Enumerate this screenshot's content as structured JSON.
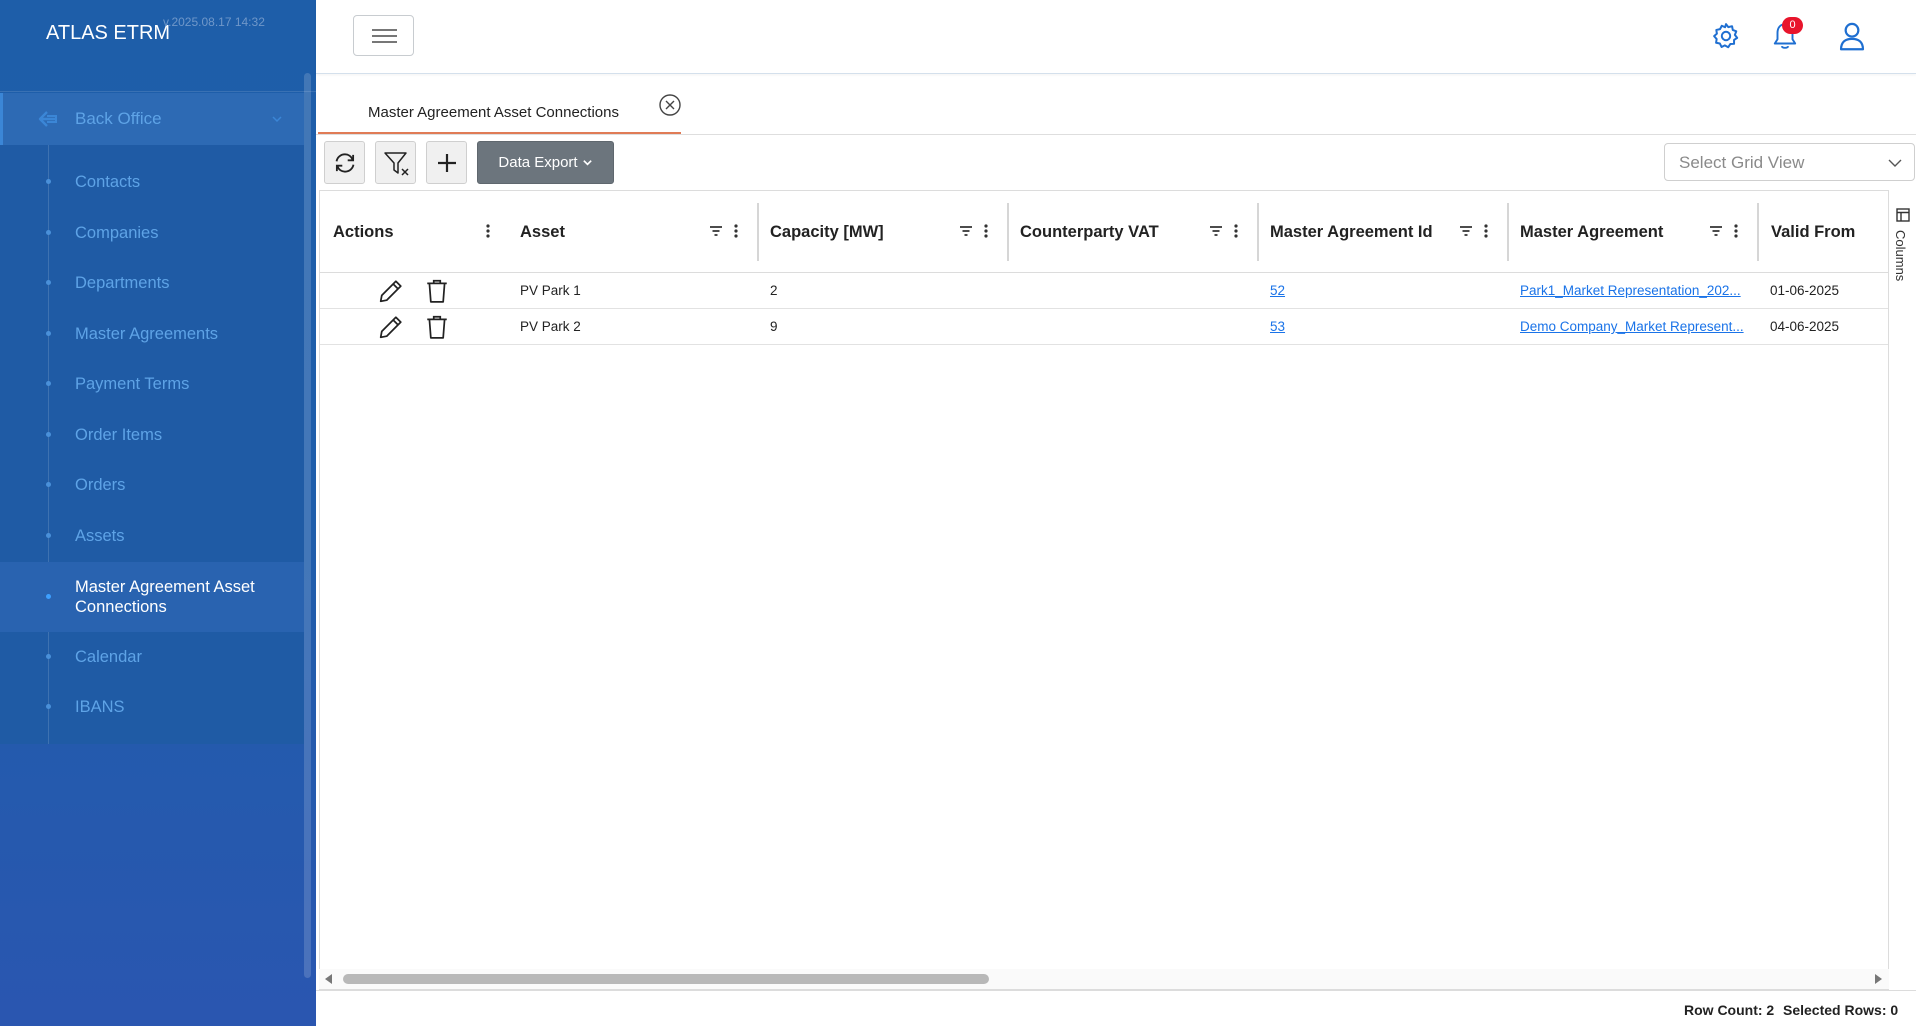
{
  "app": {
    "title": "ATLAS ETRM",
    "version": "v.2025.08.17 14:32"
  },
  "sidebar": {
    "section": {
      "label": "Back Office",
      "icon": "back-arrow-icon"
    },
    "items": [
      {
        "label": "Contacts",
        "active": false
      },
      {
        "label": "Companies",
        "active": false
      },
      {
        "label": "Departments",
        "active": false
      },
      {
        "label": "Master Agreements",
        "active": false
      },
      {
        "label": "Payment Terms",
        "active": false
      },
      {
        "label": "Order Items",
        "active": false
      },
      {
        "label": "Orders",
        "active": false
      },
      {
        "label": "Assets",
        "active": false
      },
      {
        "label": "Master Agreement Asset Connections",
        "active": true
      },
      {
        "label": "Calendar",
        "active": false
      },
      {
        "label": "IBANS",
        "active": false
      }
    ]
  },
  "header": {
    "notification_count": "0",
    "icons": [
      "menu-icon",
      "gear-icon",
      "bell-icon",
      "user-icon"
    ]
  },
  "tabs": [
    {
      "label": "Master Agreement Asset Connections"
    }
  ],
  "toolbar": {
    "refresh_icon": "refresh-icon",
    "clear_filter_icon": "filter-clear-icon",
    "add_icon": "plus-icon",
    "export_label": "Data Export",
    "grid_view_placeholder": "Select Grid View"
  },
  "grid": {
    "columns": [
      "Actions",
      "Asset",
      "Capacity [MW]",
      "Counterparty VAT",
      "Master Agreement Id",
      "Master Agreement",
      "Valid From"
    ],
    "rows": [
      {
        "asset": "PV Park 1",
        "capacity": "2",
        "counterparty_vat": "",
        "ma_id": "52",
        "master_agreement": "Park1_Market Representation_202...",
        "valid_from": "01-06-2025"
      },
      {
        "asset": "PV Park 2",
        "capacity": "9",
        "counterparty_vat": "",
        "ma_id": "53",
        "master_agreement": "Demo Company_Market Represent...",
        "valid_from": "04-06-2025"
      }
    ],
    "columns_panel_label": "Columns"
  },
  "status": {
    "row_count_label": "Row Count:",
    "row_count": "2",
    "selected_label": "Selected Rows:",
    "selected": "0"
  },
  "colors": {
    "sidebar": "#1f5eab",
    "accent": "#3b86d6",
    "badge": "#e8152c",
    "tab_underline": "#e07b56",
    "link": "#1a73e8"
  }
}
